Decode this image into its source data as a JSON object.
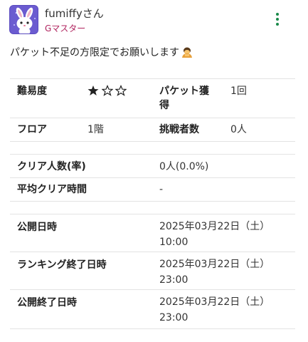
{
  "user": {
    "name": "fumiffyさん",
    "rank": "Gマスター"
  },
  "message": "パケット不足の方限定でお願いします",
  "message_emoji": "bowing-person-emoji",
  "colors": {
    "rank_text": "#b0245f",
    "menu_dots": "#1a8a4a",
    "avatar_bg": "#6b5bd0",
    "divider": "#e3e3e3"
  },
  "stats": {
    "difficulty_label": "難易度",
    "difficulty_stars_filled": 1,
    "difficulty_stars_total": 3,
    "packet_label_line1": "パケット獲",
    "packet_label_line2": "得",
    "packet_value": "1回",
    "floor_label": "フロア",
    "floor_value": "1階",
    "challengers_label": "挑戦者数",
    "challengers_value": "0人",
    "clear_count_label": "クリア人数(率)",
    "clear_count_value": "0人(0.0%)",
    "avg_clear_time_label": "平均クリア時間",
    "avg_clear_time_value": "-",
    "publish_label": "公開日時",
    "publish_date": "2025年03月22日（土）",
    "publish_time": "10:00",
    "ranking_end_label": "ランキング終了日時",
    "ranking_end_date": "2025年03月22日（土）",
    "ranking_end_time": "23:00",
    "publish_end_label": "公開終了日時",
    "publish_end_date": "2025年03月22日（土）",
    "publish_end_time": "23:00"
  }
}
